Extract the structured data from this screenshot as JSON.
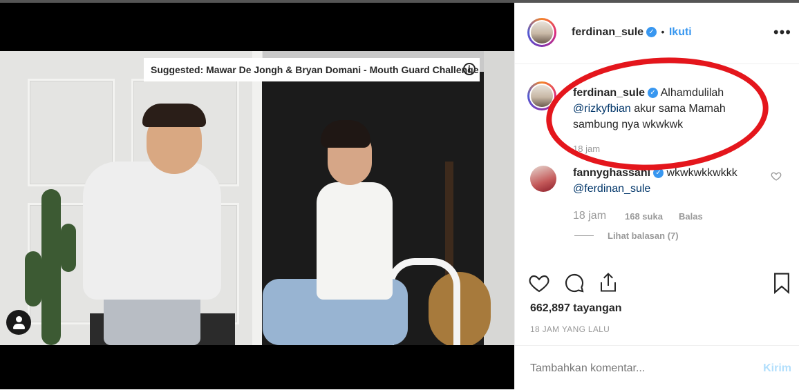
{
  "video": {
    "suggested_label": "Suggested: Mawar De Jongh & Bryan Domani - Mouth Guard Challenge",
    "info_icon": "info-icon",
    "tag_icon": "user-tag-icon"
  },
  "post": {
    "username": "ferdinan_sule",
    "separator": "•",
    "follow_label": "Ikuti",
    "more_icon": "•••"
  },
  "caption": {
    "username": "ferdinan_sule",
    "text_before": "Alhamdulilah",
    "mention": "@rizkyfbian",
    "text_after": " akur sama Mamah sambung nya wkwkwk",
    "time": "18 jam"
  },
  "comment": {
    "username": "fannyghassani",
    "text": "wkwkwkkwkkk",
    "mention": "@ferdinan_sule",
    "time": "18 jam",
    "likes": "168 suka",
    "reply_label": "Balas",
    "view_replies": "Lihat balasan (7)"
  },
  "actions": {
    "views": "662,897 tayangan",
    "timestamp": "18 JAM YANG LALU"
  },
  "add_comment": {
    "placeholder": "Tambahkan komentar...",
    "submit_label": "Kirim"
  },
  "colors": {
    "accent": "#3897f0",
    "annotation": "#e4161c",
    "mention": "#003569"
  }
}
